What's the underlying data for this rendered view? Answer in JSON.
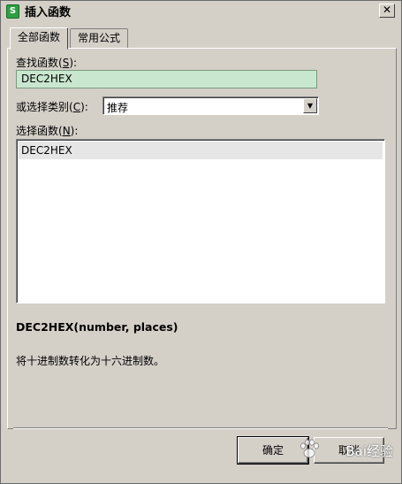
{
  "window": {
    "title": "插入函数",
    "app_icon": "S",
    "close": "✕"
  },
  "tabs": [
    {
      "label": "全部函数",
      "active": true
    },
    {
      "label": "常用公式",
      "active": false
    }
  ],
  "search": {
    "label": "查找函数(",
    "hotkey": "S",
    "label_end": "):",
    "value": "DEC2HEX"
  },
  "category": {
    "label": "或选择类别(",
    "hotkey": "C",
    "label_end": "):",
    "value": "推荐"
  },
  "functions": {
    "label": "选择函数(",
    "hotkey": "N",
    "label_end": "):",
    "items": [
      "DEC2HEX"
    ]
  },
  "detail": {
    "signature": "DEC2HEX(number, places)",
    "description": "将十进制数转化为十六进制数。"
  },
  "buttons": {
    "ok": "确定",
    "cancel": "取消"
  },
  "watermark": "Bai经验"
}
